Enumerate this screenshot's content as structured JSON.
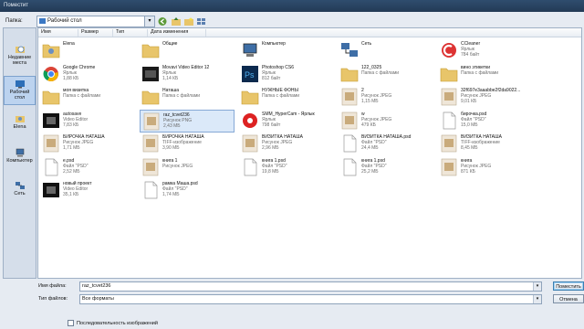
{
  "window": {
    "title": "Поместит"
  },
  "lookin": {
    "label": "Папка:",
    "value": "Рабочий стол"
  },
  "places": [
    {
      "label": "Недавние места",
      "icon": "recent-places-icon"
    },
    {
      "label": "Рабочий стол",
      "icon": "desktop-icon",
      "selected": true
    },
    {
      "label": "Elena",
      "icon": "user-folder-icon"
    },
    {
      "label": "Компьютер",
      "icon": "computer-icon"
    },
    {
      "label": "Сеть",
      "icon": "network-icon"
    }
  ],
  "columns": [
    "Имя",
    "Размер",
    "Тип",
    "Дата изменения"
  ],
  "items": [
    {
      "name": "Elena",
      "type": "",
      "size": "",
      "icon": "user-folder-icon"
    },
    {
      "name": "Общие",
      "type": "",
      "size": "",
      "icon": "folder-icon"
    },
    {
      "name": "Компьютер",
      "type": "",
      "size": "",
      "icon": "computer-icon"
    },
    {
      "name": "Сеть",
      "type": "",
      "size": "",
      "icon": "network-icon"
    },
    {
      "name": "CCleaner",
      "type": "Ярлык",
      "size": "784 байт",
      "icon": "ccleaner-icon"
    },
    {
      "name": "Google Chrome",
      "type": "Ярлык",
      "size": "1,88 КБ",
      "icon": "chrome-icon"
    },
    {
      "name": "Movavi Video Editor 12",
      "type": "Ярлык",
      "size": "1,14 КБ",
      "icon": "movavi-icon"
    },
    {
      "name": "Photoshop CS6",
      "type": "Ярлык",
      "size": "812 байт",
      "icon": "photoshop-icon"
    },
    {
      "name": "122_0325",
      "type": "Папка с файлами",
      "size": "",
      "icon": "folder-icon"
    },
    {
      "name": "вино этикетки",
      "type": "Папка с файлами",
      "size": "",
      "icon": "folder-icon"
    },
    {
      "name": "моя визитка",
      "type": "Папка с файлами",
      "size": "",
      "icon": "folder-icon"
    },
    {
      "name": "Наташа",
      "type": "Папка с файлами",
      "size": "",
      "icon": "folder-icon"
    },
    {
      "name": "НУЖНЫЕ ФОНЫ",
      "type": "Папка с файлами",
      "size": "",
      "icon": "folder-icon"
    },
    {
      "name": "2",
      "type": "Рисунок JPEG",
      "size": "1,15 МБ",
      "icon": "image-thumb-icon"
    },
    {
      "name": "32f697e3aaabbe2f2da9022...",
      "type": "Рисунок JPEG",
      "size": "9,01 КБ",
      "icon": "image-thumb-icon"
    },
    {
      "name": "autosave",
      "type": "Video Editor",
      "size": "7,83 КБ",
      "icon": "video-project-icon"
    },
    {
      "name": "raz_tcvet236",
      "type": "Рисунок PNG",
      "size": "2,43 МБ",
      "icon": "image-thumb-icon",
      "selected": true
    },
    {
      "name": "SMM_HyperCam - Ярлык",
      "type": "Ярлык",
      "size": "798 байт",
      "icon": "hypercam-icon"
    },
    {
      "name": "w",
      "type": "Рисунок JPEG",
      "size": "479 КБ",
      "icon": "image-thumb-icon"
    },
    {
      "name": "бирочка.psd",
      "type": "Файл \"PSD\"",
      "size": "15,0 МБ",
      "icon": "psd-icon"
    },
    {
      "name": "БИРОЧКА НАТАША",
      "type": "Рисунок JPEG",
      "size": "1,71 МБ",
      "icon": "image-thumb-icon"
    },
    {
      "name": "БИРОЧКА НАТАША",
      "type": "TIFF-изображение",
      "size": "3,90 МБ",
      "icon": "image-thumb-icon"
    },
    {
      "name": "ВИЗИТКА НАТАША",
      "type": "Рисунок JPEG",
      "size": "2,96 МБ",
      "icon": "image-thumb-icon"
    },
    {
      "name": "ВИЗИТКА НАТАША.psd",
      "type": "Файл \"PSD\"",
      "size": "24,4 МБ",
      "icon": "psd-icon"
    },
    {
      "name": "ВИЗИТКА НАТАША",
      "type": "TIFF-изображение",
      "size": "8,45 МБ",
      "icon": "image-thumb-icon"
    },
    {
      "name": "e.psd",
      "type": "Файл \"PSD\"",
      "size": "2,52 МБ",
      "icon": "psd-icon"
    },
    {
      "name": "книга 1",
      "type": "Рисунок JPEG",
      "size": "",
      "icon": "image-thumb-icon"
    },
    {
      "name": "книга 1.psd",
      "type": "Файл \"PSD\"",
      "size": "19,8 МБ",
      "icon": "psd-icon"
    },
    {
      "name": "книга 1.psd",
      "type": "Файл \"PSD\"",
      "size": "25,2 МБ",
      "icon": "psd-icon"
    },
    {
      "name": "книга",
      "type": "Рисунок JPEG",
      "size": "871 КБ",
      "icon": "image-thumb-icon"
    },
    {
      "name": "новый проект",
      "type": "Video Editor",
      "size": "35,1 КБ",
      "icon": "video-project-icon"
    },
    {
      "name": "рамка Маша.psd",
      "type": "Файл \"PSD\"",
      "size": "1,74 МБ",
      "icon": "psd-icon"
    }
  ],
  "filename": {
    "label": "Имя файла:",
    "value": "raz_tcvet236"
  },
  "filetype": {
    "label": "Тип файлов:",
    "value": "Все форматы"
  },
  "buttons": {
    "place": "Поместить",
    "cancel": "Отмена"
  },
  "sequence": {
    "label": "Последовательность изображений"
  },
  "colors": {
    "selection": "#dbe9f9",
    "selection_border": "#86a9d6",
    "folder": "#e8c56a"
  }
}
